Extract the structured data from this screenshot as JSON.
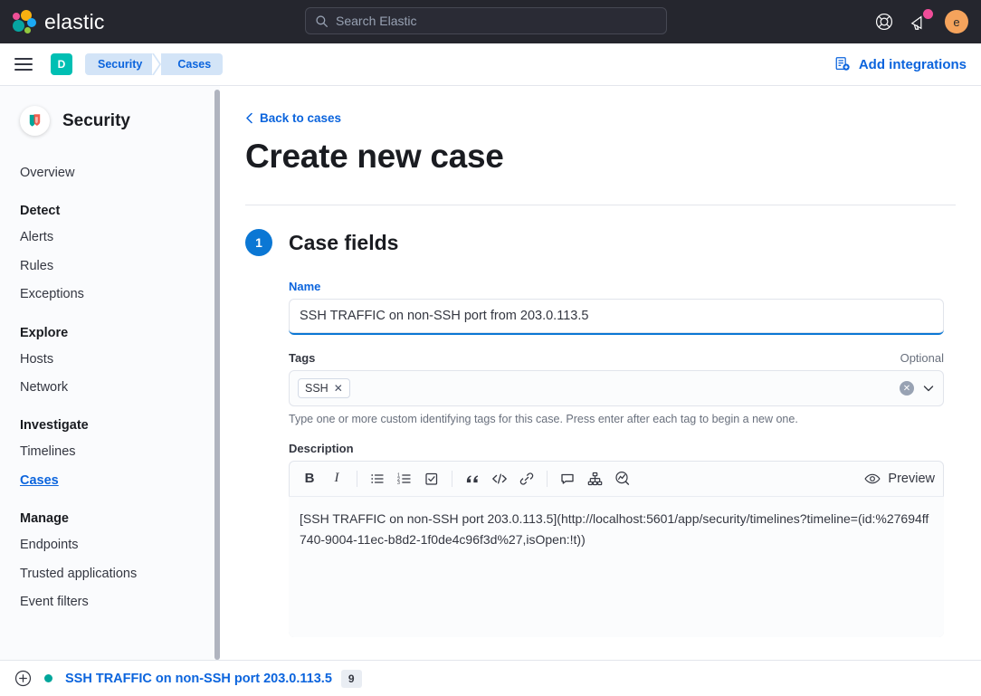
{
  "topbar": {
    "brand_name": "elastic",
    "search": {
      "placeholder": "Search Elastic",
      "icon": "search-icon"
    },
    "help_icon": "lifebuoy-help-icon",
    "news_icon": "announcement-megaphone-icon",
    "avatar_initial": "e",
    "avatar_color": "#f5a35c"
  },
  "chromebar": {
    "menu_icon": "hamburger-menu-icon",
    "space_initial": "D",
    "space_color": "#00bfb3",
    "breadcrumbs": [
      "Security",
      "Cases"
    ],
    "add_integrations": {
      "label": "Add integrations",
      "icon": "integrations-add-icon"
    }
  },
  "sidebar": {
    "app_title": "Security",
    "app_icon": "security-shield-icon",
    "groups": [
      {
        "title": "",
        "items": [
          {
            "label": "Overview",
            "selected": false
          }
        ]
      },
      {
        "title": "Detect",
        "items": [
          {
            "label": "Alerts",
            "selected": false
          },
          {
            "label": "Rules",
            "selected": false
          },
          {
            "label": "Exceptions",
            "selected": false
          }
        ]
      },
      {
        "title": "Explore",
        "items": [
          {
            "label": "Hosts",
            "selected": false
          },
          {
            "label": "Network",
            "selected": false
          }
        ]
      },
      {
        "title": "Investigate",
        "items": [
          {
            "label": "Timelines",
            "selected": false
          },
          {
            "label": "Cases",
            "selected": true
          }
        ]
      },
      {
        "title": "Manage",
        "items": [
          {
            "label": "Endpoints",
            "selected": false
          },
          {
            "label": "Trusted applications",
            "selected": false
          },
          {
            "label": "Event filters",
            "selected": false
          }
        ]
      }
    ]
  },
  "main": {
    "back_link": {
      "label": "Back to cases",
      "icon": "chevron-left-icon"
    },
    "page_title": "Create new case",
    "step": {
      "number": "1",
      "title": "Case fields",
      "accent": "#0b77d4"
    },
    "name_field": {
      "label": "Name",
      "value": "SSH TRAFFIC on non-SSH port from 203.0.113.5",
      "placeholder": ""
    },
    "tags_field": {
      "label": "Tags",
      "optional_label": "Optional",
      "tags": [
        "SSH"
      ],
      "clear_icon": "clear-circle-icon",
      "chevron_icon": "chevron-down-icon",
      "help_text": "Type one or more custom identifying tags for this case. Press enter after each tag to begin a new one."
    },
    "description_field": {
      "label": "Description",
      "toolbar": [
        {
          "name": "bold-icon",
          "label": "B"
        },
        {
          "name": "italic-icon",
          "label": "I"
        },
        {
          "name": "bulleted-list-icon",
          "label": ""
        },
        {
          "name": "numbered-list-icon",
          "label": ""
        },
        {
          "name": "checklist-icon",
          "label": ""
        },
        {
          "name": "quote-icon",
          "label": ""
        },
        {
          "name": "code-icon",
          "label": ""
        },
        {
          "name": "link-icon",
          "label": ""
        },
        {
          "name": "comment-icon",
          "label": ""
        },
        {
          "name": "timeline-hierarchy-icon",
          "label": ""
        },
        {
          "name": "lens-visualization-icon",
          "label": ""
        }
      ],
      "preview_button": {
        "label": "Preview",
        "icon": "eye-preview-icon"
      },
      "value": "[SSH TRAFFIC on non-SSH port 203.0.113.5](http://localhost:5601/app/security/timelines?timeline=(id:%27694ff740-9004-11ec-b8d2-1f0de4c96f3d%27,isOpen:!t))"
    }
  },
  "timelinebar": {
    "add_icon": "plus-in-circle-icon",
    "status_color": "#00a69b",
    "timeline_name": "SSH TRAFFIC on non-SSH port 203.0.113.5",
    "badge_count": "9"
  }
}
